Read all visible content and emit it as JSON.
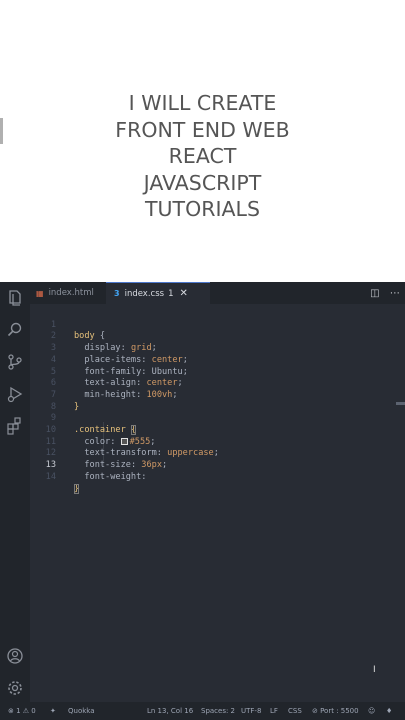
{
  "preview": {
    "lines": [
      "I will create",
      "front end web",
      "React",
      "Javascript",
      "tutorials"
    ],
    "text_color": "#555555"
  },
  "tabs": [
    {
      "icon": "html-file-icon",
      "label": "index.html"
    },
    {
      "icon": "css-file-icon",
      "icon_glyph": "3",
      "label": "index.css",
      "badge": "1",
      "close": "✕"
    }
  ],
  "code_lines": [
    {
      "n": "1"
    },
    {
      "n": "2"
    },
    {
      "n": "3"
    },
    {
      "n": "4"
    },
    {
      "n": "5"
    },
    {
      "n": "6"
    },
    {
      "n": "7"
    },
    {
      "n": "8"
    },
    {
      "n": "9"
    },
    {
      "n": "10"
    },
    {
      "n": "11"
    },
    {
      "n": "12"
    },
    {
      "n": "13"
    },
    {
      "n": "14"
    }
  ],
  "code": {
    "l1_sel": "body",
    "l1_brace": "{",
    "l2_prop": "display",
    "l2_val": "grid",
    "l3_prop": "place-items",
    "l3_val": "center",
    "l4_prop": "font-family",
    "l4_val": "Ubuntu",
    "l5_prop": "text-align",
    "l5_val": "center",
    "l6_prop": "min-height",
    "l6_val": "100vh",
    "l7_brace": "}",
    "l9_sel": ".container",
    "l9_brace": "{",
    "l10_prop": "color",
    "l10_val": "#555",
    "l11_prop": "text-transform",
    "l11_val": "uppercase",
    "l12_prop": "font-size",
    "l12_val": "36px",
    "l13_prop": "font-weight",
    "l14_brace": "}"
  },
  "swatch_color": "#555555",
  "status": {
    "problems": "⊗ 1 ⚠ 0",
    "quokka": "Quokka",
    "position": "Ln 13, Col 16",
    "spaces": "Spaces: 2",
    "encoding": "UTF-8",
    "eol": "LF",
    "language": "CSS",
    "port": "⊘ Port : 5500"
  },
  "colors": {
    "editor_bg": "#282c34",
    "panel_bg": "#21252b",
    "selector": "#e5c07b",
    "value": "#d19a66",
    "property": "#abb2bf"
  }
}
